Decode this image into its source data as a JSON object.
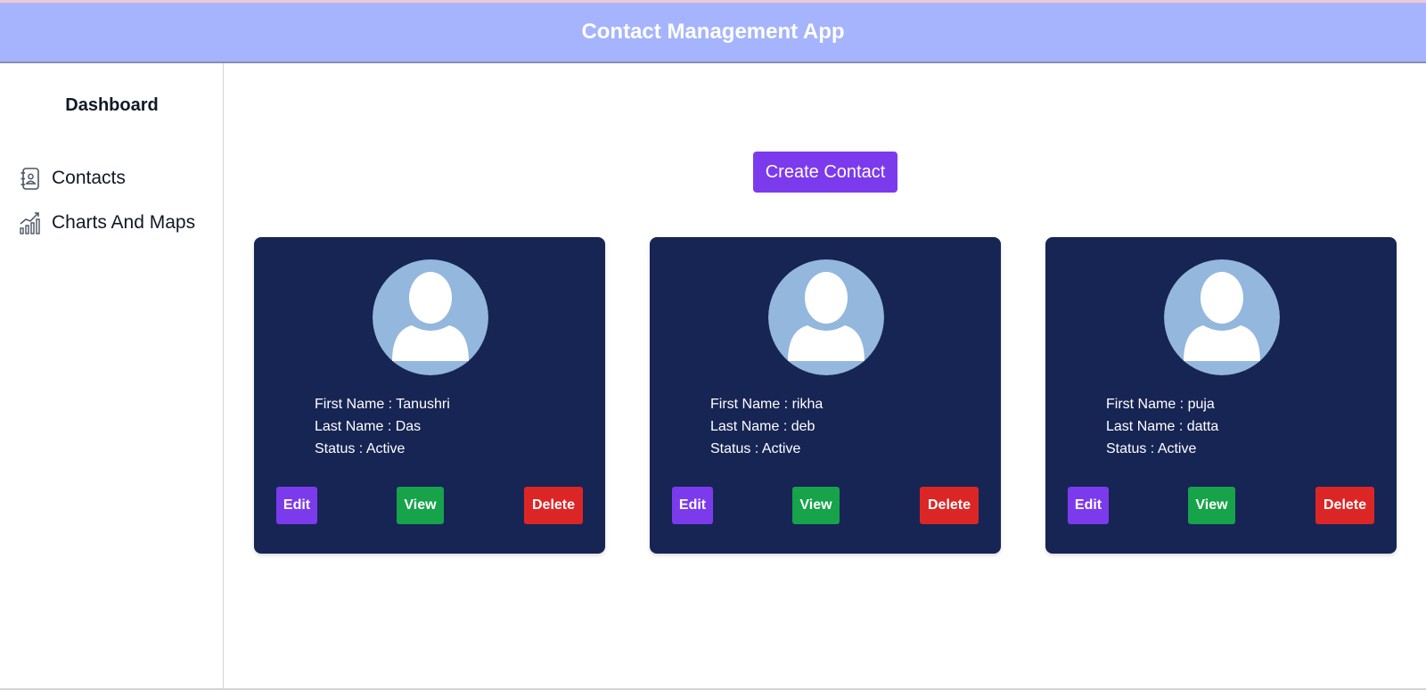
{
  "header": {
    "title": "Contact Management App"
  },
  "sidebar": {
    "title": "Dashboard",
    "items": [
      {
        "label": "Contacts",
        "icon": "contacts-book-icon"
      },
      {
        "label": "Charts And Maps",
        "icon": "line-chart-icon"
      }
    ]
  },
  "main": {
    "create_label": "Create Contact",
    "cards": [
      {
        "first_name": "First Name : Tanushri",
        "last_name": "Last Name : Das",
        "status": "Status : Active",
        "edit": "Edit",
        "view": "View",
        "delete": "Delete"
      },
      {
        "first_name": "First Name : rikha",
        "last_name": "Last Name : deb",
        "status": "Status : Active",
        "edit": "Edit",
        "view": "View",
        "delete": "Delete"
      },
      {
        "first_name": "First Name : puja",
        "last_name": "Last Name : datta",
        "status": "Status : Active",
        "edit": "Edit",
        "view": "View",
        "delete": "Delete"
      }
    ]
  },
  "colors": {
    "header": "#a5b4fc",
    "card": "#172554",
    "primary": "#7c3aed",
    "view": "#16a34a",
    "delete": "#dc2626",
    "avatar_bg": "#93b7dd"
  }
}
